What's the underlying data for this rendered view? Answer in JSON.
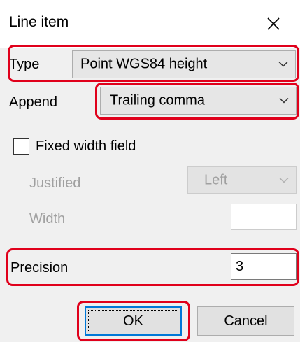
{
  "dialog": {
    "title": "Line item",
    "close_glyph": "✕"
  },
  "type": {
    "label": "Type",
    "value": "Point WGS84 height"
  },
  "append": {
    "label": "Append",
    "value": "Trailing comma"
  },
  "fixed_width": {
    "label": "Fixed width field",
    "checked": false
  },
  "justified": {
    "label": "Justified",
    "value": "Left",
    "enabled": false
  },
  "width": {
    "label": "Width",
    "value": "",
    "enabled": false
  },
  "precision": {
    "label": "Precision",
    "value": "3"
  },
  "buttons": {
    "ok": "OK",
    "cancel": "Cancel"
  },
  "colors": {
    "highlight": "#e0001b",
    "default_button_border": "#0078d7",
    "titlebar": "#ffffff",
    "dialog_background": "#f0f0f0"
  },
  "icons": {
    "close": "close-icon",
    "dropdown": "chevron-down-icon"
  }
}
